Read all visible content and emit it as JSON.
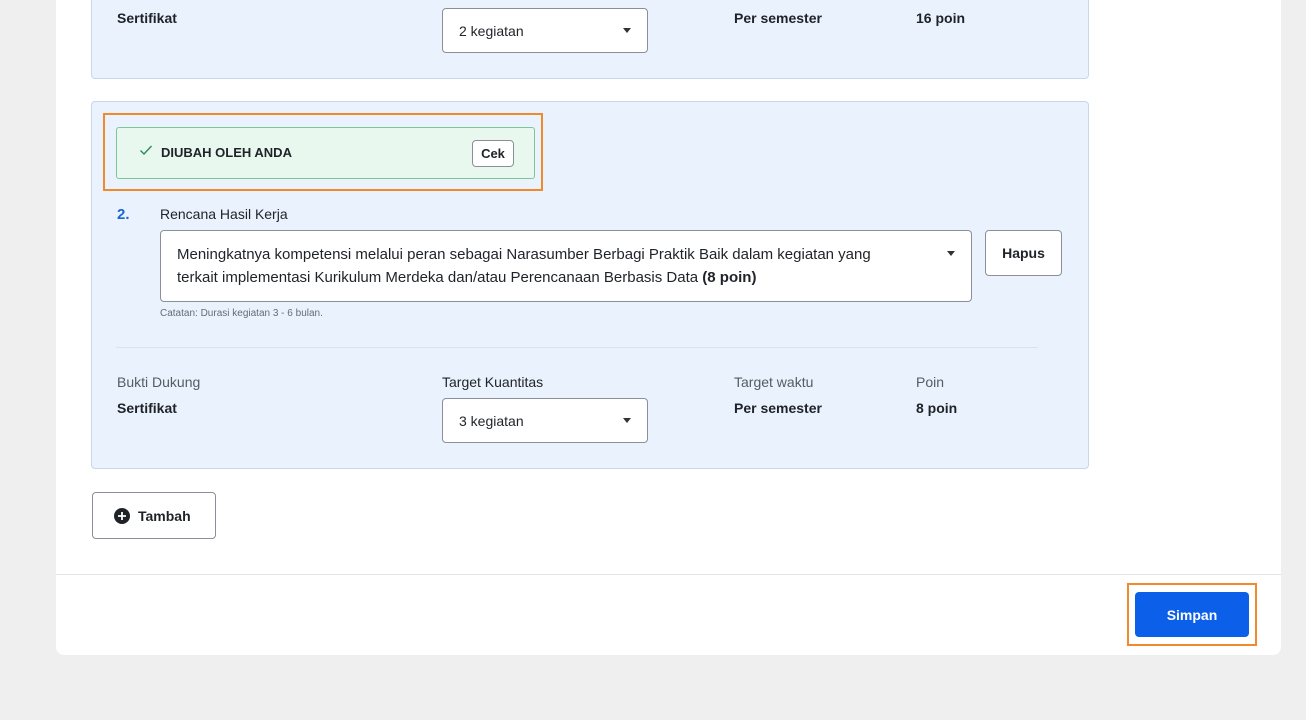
{
  "card1": {
    "bukti_value": "Sertifikat",
    "target_select_value": "2 kegiatan",
    "waktu_value": "Per semester",
    "poin_value": "16 poin"
  },
  "card2": {
    "status_label": "DIUBAH OLEH ANDA",
    "cek_label": "Cek",
    "item_number": "2.",
    "rhk_label": "Rencana Hasil Kerja",
    "rhk_text": "Meningkatnya kompetensi melalui peran sebagai Narasumber Berbagi Praktik Baik dalam kegiatan yang terkait implementasi Kurikulum Merdeka dan/atau Perencanaan Berbasis Data ",
    "rhk_points": "(8 poin)",
    "hapus_label": "Hapus",
    "note": "Catatan: Durasi kegiatan 3 - 6 bulan.",
    "bukti_label": "Bukti Dukung",
    "bukti_value": "Sertifikat",
    "target_label": "Target Kuantitas",
    "target_select_value": "3 kegiatan",
    "waktu_label": "Target waktu",
    "waktu_value": "Per semester",
    "poin_label": "Poin",
    "poin_value": "8 poin"
  },
  "add_button_label": "Tambah",
  "save_button_label": "Simpan",
  "icons": {
    "check": "check-icon",
    "plus": "plus-circle-icon",
    "caret": "caret-down-icon"
  },
  "colors": {
    "primary": "#0b5fe8",
    "highlight": "#f08a2c",
    "card_bg": "#eaf2fd",
    "success_bg": "#e8f8ee",
    "number_blue": "#1a66d6"
  }
}
